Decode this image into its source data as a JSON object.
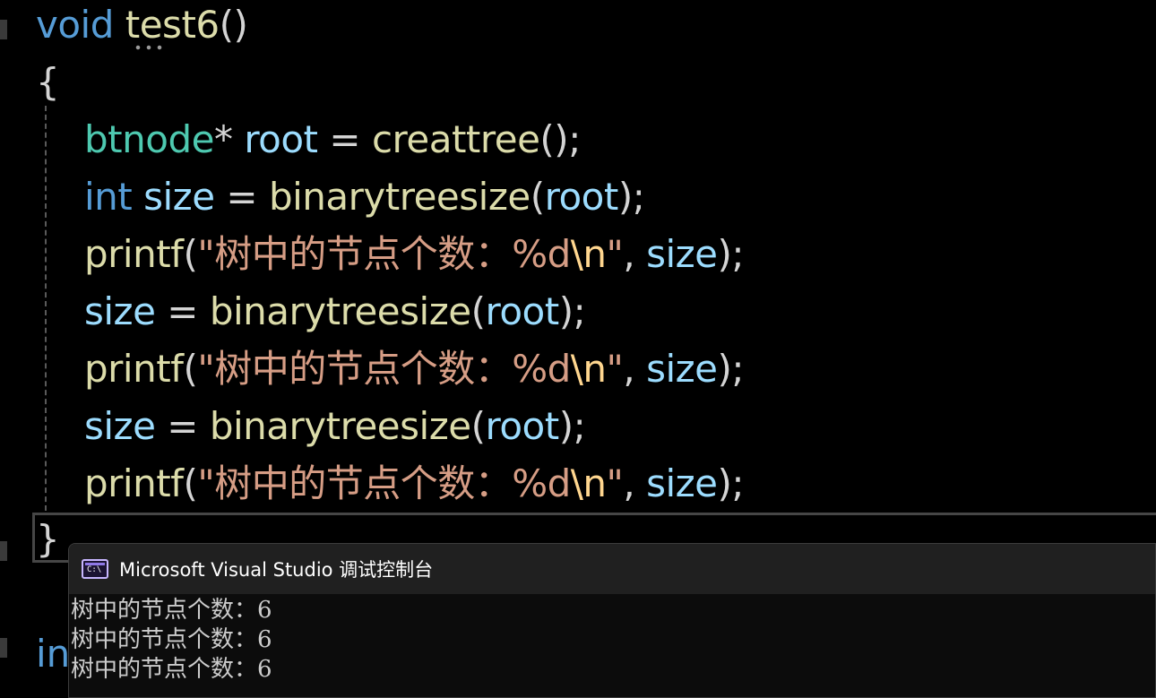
{
  "editor": {
    "lines": [
      {
        "tokens": [
          {
            "t": "void",
            "c": "kw"
          },
          {
            "t": " ",
            "c": "op"
          },
          {
            "t": "test6",
            "c": "fn"
          },
          {
            "t": "()",
            "c": "op"
          }
        ]
      },
      {
        "tokens": [
          {
            "t": "{",
            "c": "brace"
          }
        ]
      },
      {
        "indent": true,
        "tokens": [
          {
            "t": "btnode",
            "c": "type"
          },
          {
            "t": "* ",
            "c": "op"
          },
          {
            "t": "root",
            "c": "var"
          },
          {
            "t": " = ",
            "c": "op"
          },
          {
            "t": "creattree",
            "c": "fn"
          },
          {
            "t": "();",
            "c": "op"
          }
        ]
      },
      {
        "indent": true,
        "tokens": [
          {
            "t": "int",
            "c": "kw"
          },
          {
            "t": " ",
            "c": "op"
          },
          {
            "t": "size",
            "c": "var"
          },
          {
            "t": " = ",
            "c": "op"
          },
          {
            "t": "binarytreesize",
            "c": "fn"
          },
          {
            "t": "(",
            "c": "op"
          },
          {
            "t": "root",
            "c": "var"
          },
          {
            "t": ");",
            "c": "op"
          }
        ]
      },
      {
        "indent": true,
        "tokens": [
          {
            "t": "printf",
            "c": "fn"
          },
          {
            "t": "(",
            "c": "op"
          },
          {
            "t": "\"树中的节点个数：%d",
            "c": "str"
          },
          {
            "t": "\\n",
            "c": "esc"
          },
          {
            "t": "\"",
            "c": "str"
          },
          {
            "t": ", ",
            "c": "op"
          },
          {
            "t": "size",
            "c": "var"
          },
          {
            "t": ");",
            "c": "op"
          }
        ]
      },
      {
        "indent": true,
        "tokens": [
          {
            "t": "size",
            "c": "var"
          },
          {
            "t": " = ",
            "c": "op"
          },
          {
            "t": "binarytreesize",
            "c": "fn"
          },
          {
            "t": "(",
            "c": "op"
          },
          {
            "t": "root",
            "c": "var"
          },
          {
            "t": ");",
            "c": "op"
          }
        ]
      },
      {
        "indent": true,
        "tokens": [
          {
            "t": "printf",
            "c": "fn"
          },
          {
            "t": "(",
            "c": "op"
          },
          {
            "t": "\"树中的节点个数：%d",
            "c": "str"
          },
          {
            "t": "\\n",
            "c": "esc"
          },
          {
            "t": "\"",
            "c": "str"
          },
          {
            "t": ", ",
            "c": "op"
          },
          {
            "t": "size",
            "c": "var"
          },
          {
            "t": ");",
            "c": "op"
          }
        ]
      },
      {
        "indent": true,
        "tokens": [
          {
            "t": "size",
            "c": "var"
          },
          {
            "t": " = ",
            "c": "op"
          },
          {
            "t": "binarytreesize",
            "c": "fn"
          },
          {
            "t": "(",
            "c": "op"
          },
          {
            "t": "root",
            "c": "var"
          },
          {
            "t": ");",
            "c": "op"
          }
        ]
      },
      {
        "indent": true,
        "tokens": [
          {
            "t": "printf",
            "c": "fn"
          },
          {
            "t": "(",
            "c": "op"
          },
          {
            "t": "\"树中的节点个数：%d",
            "c": "str"
          },
          {
            "t": "\\n",
            "c": "esc"
          },
          {
            "t": "\"",
            "c": "str"
          },
          {
            "t": ", ",
            "c": "op"
          },
          {
            "t": "size",
            "c": "var"
          },
          {
            "t": ");",
            "c": "op"
          }
        ]
      },
      {
        "tokens": [
          {
            "t": "}",
            "c": "brace"
          }
        ]
      }
    ],
    "partial_next_line": "in"
  },
  "console": {
    "icon_label": "C:\\",
    "title": "Microsoft Visual Studio 调试控制台",
    "output_lines": [
      "树中的节点个数：6",
      "树中的节点个数：6",
      "树中的节点个数：6"
    ]
  },
  "colors": {
    "keyword": "#569cd6",
    "function": "#dcdcaa",
    "type": "#4ec9b0",
    "variable": "#9cdcfe",
    "string": "#d69d85",
    "escape": "#ffd68f",
    "background": "#000000"
  }
}
